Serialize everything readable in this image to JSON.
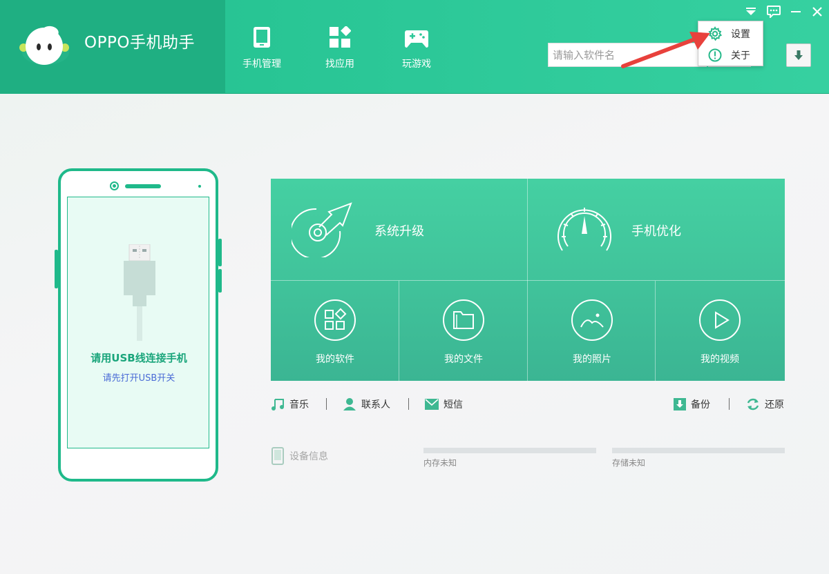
{
  "app": {
    "title": "OPPO手机助手"
  },
  "nav": [
    {
      "label": "手机管理",
      "icon": "phone-manage-icon"
    },
    {
      "label": "找应用",
      "icon": "apps-grid-icon"
    },
    {
      "label": "玩游戏",
      "icon": "gamepad-icon"
    }
  ],
  "search": {
    "placeholder": "请输入软件名"
  },
  "menu": {
    "items": [
      {
        "label": "设置",
        "icon": "gear-icon"
      },
      {
        "label": "关于",
        "icon": "info-icon"
      }
    ]
  },
  "phone": {
    "connect_title": "请用USB线连接手机",
    "connect_subtitle": "请先打开USB开关"
  },
  "tiles": {
    "big": [
      {
        "label": "系统升级",
        "icon": "system-upgrade-icon"
      },
      {
        "label": "手机优化",
        "icon": "speedometer-icon"
      }
    ],
    "small": [
      {
        "label": "我的软件",
        "icon": "my-apps-icon"
      },
      {
        "label": "我的文件",
        "icon": "folder-icon"
      },
      {
        "label": "我的照片",
        "icon": "photo-icon"
      },
      {
        "label": "我的视频",
        "icon": "play-icon"
      }
    ]
  },
  "shortcuts": {
    "left": [
      {
        "label": "音乐",
        "icon": "music-icon"
      },
      {
        "label": "联系人",
        "icon": "contact-icon"
      },
      {
        "label": "短信",
        "icon": "mail-icon"
      }
    ],
    "right": [
      {
        "label": "备份",
        "icon": "backup-icon"
      },
      {
        "label": "还原",
        "icon": "restore-icon"
      }
    ]
  },
  "device": {
    "label": "设备信息",
    "memory_label": "内存未知",
    "storage_label": "存储未知"
  },
  "colors": {
    "brand": "#22c08e",
    "brand_dark": "#1faf82",
    "tile": "#42c69c",
    "link": "#4a6bd6",
    "annotation_arrow": "#e8413c"
  }
}
